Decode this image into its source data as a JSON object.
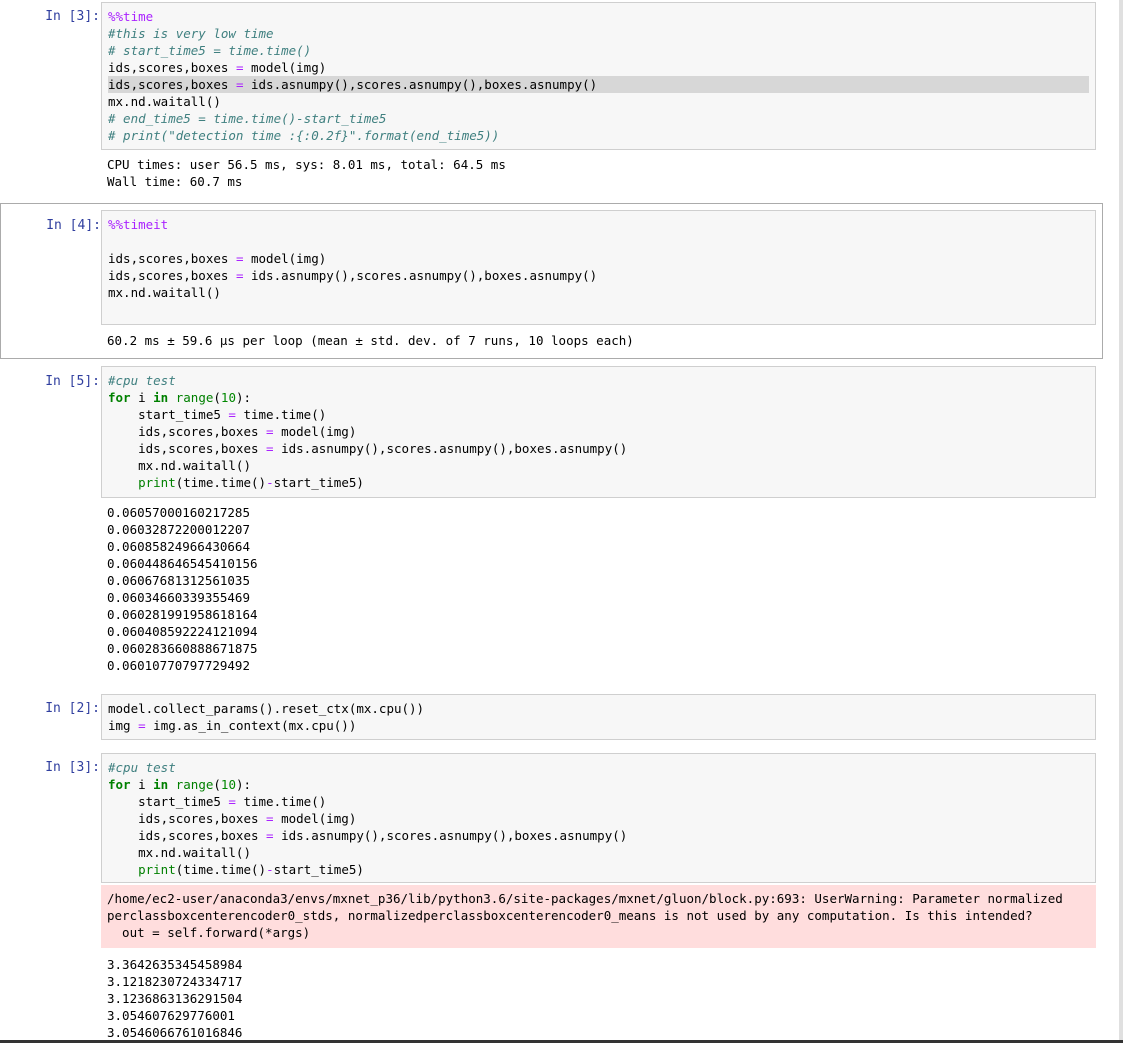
{
  "cells": [
    {
      "prompt": "In [3]:",
      "code": [
        [
          {
            "t": "%%time",
            "c": "magic"
          }
        ],
        [
          {
            "t": "#this is very low time",
            "c": "comment"
          }
        ],
        [
          {
            "t": "# start_time5 = time.time()",
            "c": "comment"
          }
        ],
        [
          {
            "t": "ids,scores,boxes "
          },
          {
            "t": "=",
            "c": "op"
          },
          {
            "t": " model(img)"
          }
        ],
        [
          {
            "t": "ids,scores,boxes "
          },
          {
            "t": "=",
            "c": "op"
          },
          {
            "t": " ids.asnumpy(),scores.asnumpy(),boxes.asnumpy()"
          }
        ],
        [
          {
            "t": "mx.nd.waitall()"
          }
        ],
        [
          {
            "t": "# end_time5 = time.time()-start_time5",
            "c": "comment"
          }
        ],
        [
          {
            "t": "# print(\"detection time :{:0.2f}\".format(end_time5))",
            "c": "comment"
          }
        ]
      ],
      "output": [
        "CPU times: user 56.5 ms, sys: 8.01 ms, total: 64.5 ms",
        "Wall time: 60.7 ms"
      ]
    },
    {
      "prompt": "In [4]:",
      "code": [
        [
          {
            "t": "%%timeit",
            "c": "magic"
          }
        ],
        [
          {
            "t": ""
          }
        ],
        [
          {
            "t": "ids,scores,boxes "
          },
          {
            "t": "=",
            "c": "op"
          },
          {
            "t": " model(img)"
          }
        ],
        [
          {
            "t": "ids,scores,boxes "
          },
          {
            "t": "=",
            "c": "op"
          },
          {
            "t": " ids.asnumpy(),scores.asnumpy(),boxes.asnumpy()"
          }
        ],
        [
          {
            "t": "mx.nd.waitall()"
          }
        ],
        [
          {
            "t": ""
          }
        ]
      ],
      "output": [
        "60.2 ms ± 59.6 µs per loop (mean ± std. dev. of 7 runs, 10 loops each)"
      ]
    },
    {
      "prompt": "In [5]:",
      "code": [
        [
          {
            "t": "#cpu test",
            "c": "comment"
          }
        ],
        [
          {
            "t": "for",
            "c": "kw"
          },
          {
            "t": " i "
          },
          {
            "t": "in",
            "c": "kw"
          },
          {
            "t": " "
          },
          {
            "t": "range",
            "c": "builtin"
          },
          {
            "t": "("
          },
          {
            "t": "10",
            "c": "num"
          },
          {
            "t": "):"
          }
        ],
        [
          {
            "t": "    start_time5 "
          },
          {
            "t": "=",
            "c": "op"
          },
          {
            "t": " time.time()"
          }
        ],
        [
          {
            "t": "    ids,scores,boxes "
          },
          {
            "t": "=",
            "c": "op"
          },
          {
            "t": " model(img)"
          }
        ],
        [
          {
            "t": "    ids,scores,boxes "
          },
          {
            "t": "=",
            "c": "op"
          },
          {
            "t": " ids.asnumpy(),scores.asnumpy(),boxes.asnumpy()"
          }
        ],
        [
          {
            "t": "    mx.nd.waitall()"
          }
        ],
        [
          {
            "t": "    "
          },
          {
            "t": "print",
            "c": "builtin"
          },
          {
            "t": "(time.time()"
          },
          {
            "t": "-",
            "c": "op"
          },
          {
            "t": "start_time5)"
          }
        ]
      ],
      "output": [
        "0.06057000160217285",
        "0.06032872200012207",
        "0.06085824966430664",
        "0.060448646545410156",
        "0.06067681312561035",
        "0.06034660339355469",
        "0.060281991958618164",
        "0.060408592224121094",
        "0.060283660888671875",
        "0.06010770797729492"
      ]
    },
    {
      "prompt": "In [2]:",
      "code": [
        [
          {
            "t": "model.collect_params().reset_ctx(mx.cpu())"
          }
        ],
        [
          {
            "t": "img "
          },
          {
            "t": "=",
            "c": "op"
          },
          {
            "t": " img.as_in_context(mx.cpu())"
          }
        ]
      ],
      "output": []
    },
    {
      "prompt": "In [3]:",
      "code": [
        [
          {
            "t": "#cpu test",
            "c": "comment"
          }
        ],
        [
          {
            "t": "for",
            "c": "kw"
          },
          {
            "t": " i "
          },
          {
            "t": "in",
            "c": "kw"
          },
          {
            "t": " "
          },
          {
            "t": "range",
            "c": "builtin"
          },
          {
            "t": "("
          },
          {
            "t": "10",
            "c": "num"
          },
          {
            "t": "):"
          }
        ],
        [
          {
            "t": "    start_time5 "
          },
          {
            "t": "=",
            "c": "op"
          },
          {
            "t": " time.time()"
          }
        ],
        [
          {
            "t": "    ids,scores,boxes "
          },
          {
            "t": "=",
            "c": "op"
          },
          {
            "t": " model(img)"
          }
        ],
        [
          {
            "t": "    ids,scores,boxes "
          },
          {
            "t": "=",
            "c": "op"
          },
          {
            "t": " ids.asnumpy(),scores.asnumpy(),boxes.asnumpy()"
          }
        ],
        [
          {
            "t": "    mx.nd.waitall()"
          }
        ],
        [
          {
            "t": "    "
          },
          {
            "t": "print",
            "c": "builtin"
          },
          {
            "t": "(time.time()"
          },
          {
            "t": "-",
            "c": "op"
          },
          {
            "t": "start_time5)"
          }
        ]
      ],
      "stderr": [
        "/home/ec2-user/anaconda3/envs/mxnet_p36/lib/python3.6/site-packages/mxnet/gluon/block.py:693: UserWarning: Parameter normalized",
        "perclassboxcenterencoder0_stds, normalizedperclassboxcenterencoder0_means is not used by any computation. Is this intended?",
        "  out = self.forward(*args)"
      ],
      "output": [
        "3.3642635345458984",
        "3.1218230724334717",
        "3.1236863136291504",
        "3.054607629776001",
        "3.0546066761016846"
      ]
    }
  ]
}
